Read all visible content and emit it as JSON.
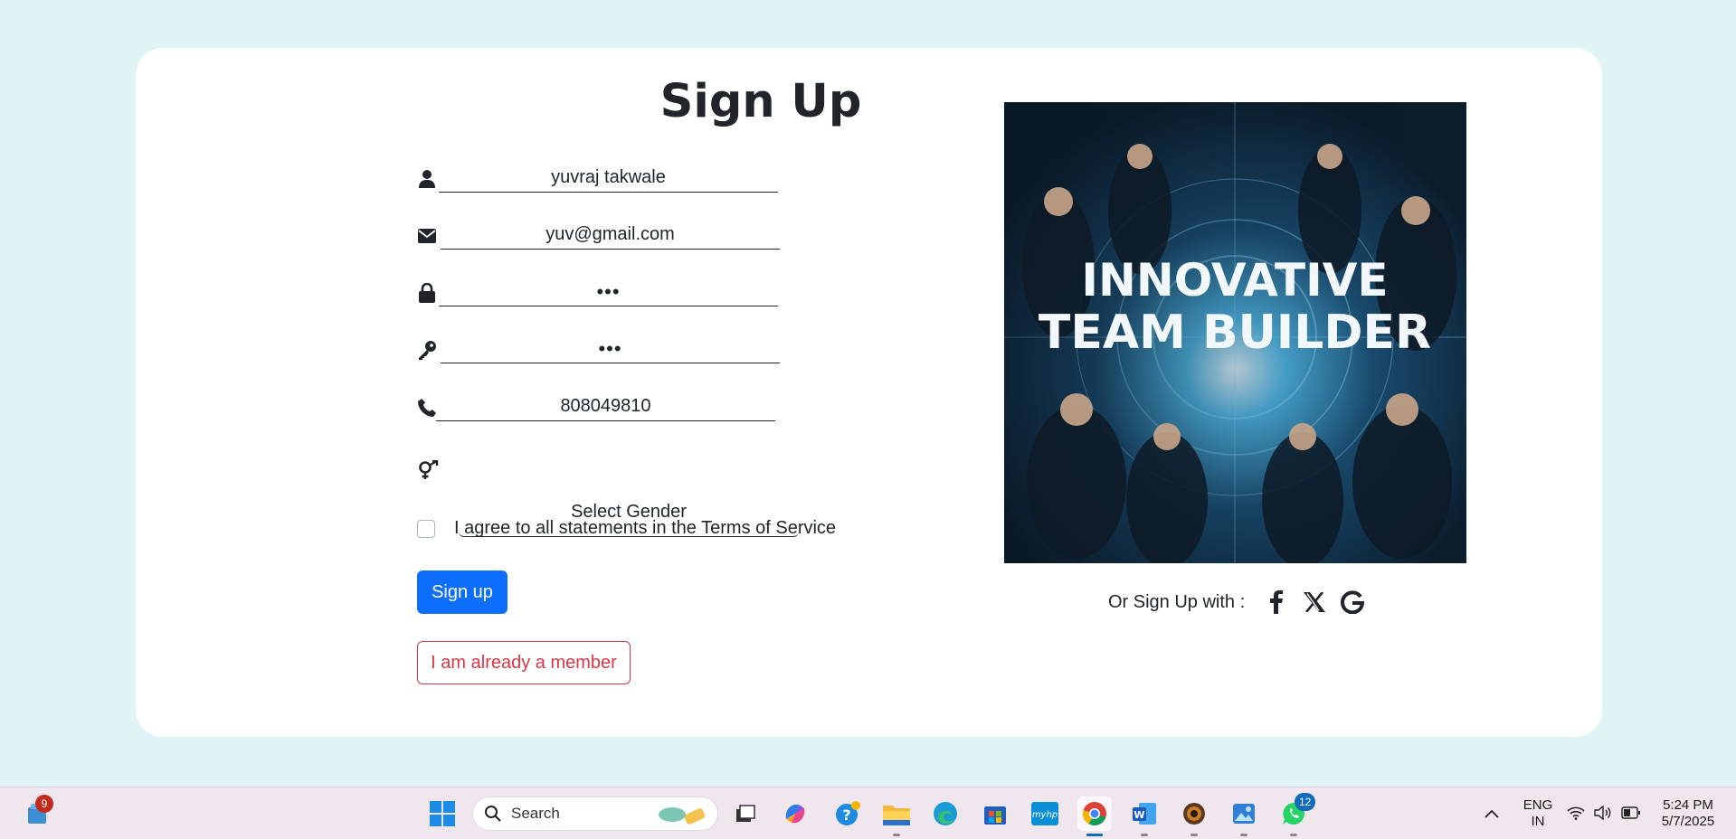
{
  "form": {
    "title": "Sign Up",
    "name_value": "yuvraj takwale",
    "email_value": "yuv@gmail.com",
    "password_value": "•••",
    "confirm_password_value": "•••",
    "phone_value": "808049810",
    "gender_placeholder": "Select Gender",
    "agree_label": "I agree to all statements in the Terms of Service",
    "signup_button": "Sign up",
    "member_button": "I am already a member"
  },
  "hero": {
    "line1": "INNOVATIVE",
    "line2": "TEAM BUILDER"
  },
  "social": {
    "label": "Or Sign Up with :",
    "icons": [
      "facebook-icon",
      "x-twitter-icon",
      "google-icon"
    ]
  },
  "taskbar": {
    "widgets_badge": "9",
    "search_label": "Search",
    "whatsapp_badge": "12",
    "lang_line1": "ENG",
    "lang_line2": "IN",
    "time": "5:24 PM",
    "date": "5/7/2025"
  },
  "colors": {
    "page_background": "#e0f3f5",
    "primary": "#0d6efd",
    "danger": "#dc3545",
    "text": "#212529"
  }
}
